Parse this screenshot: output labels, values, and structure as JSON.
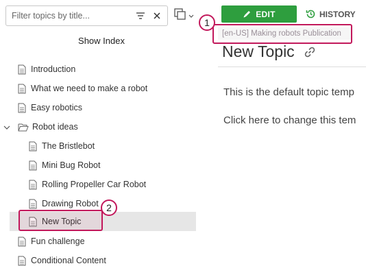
{
  "filter": {
    "placeholder": "Filter topics by title..."
  },
  "show_index_label": "Show Index",
  "tree": [
    {
      "label": "Introduction"
    },
    {
      "label": "What we need to make a robot"
    },
    {
      "label": "Easy robotics"
    },
    {
      "label": "Robot ideas"
    },
    {
      "label": "The Bristlebot"
    },
    {
      "label": "Mini Bug Robot"
    },
    {
      "label": "Rolling Propeller Car Robot"
    },
    {
      "label": "Drawing Robot"
    },
    {
      "label": "New Topic"
    },
    {
      "label": "Fun challenge"
    },
    {
      "label": "Conditional Content"
    }
  ],
  "toolbar": {
    "edit_label": "EDIT",
    "history_label": "HISTORY"
  },
  "publication_badge": "[en-US] Making robots Publication",
  "topic": {
    "title": "New Topic",
    "paragraph_1": "This is the default topic temp",
    "paragraph_2": "Click here to change this tem"
  },
  "callouts": {
    "one": "1",
    "two": "2"
  },
  "colors": {
    "edit_green": "#2e9e3e",
    "callout": "#c2185b",
    "selected_row": "#e6e6e6"
  }
}
